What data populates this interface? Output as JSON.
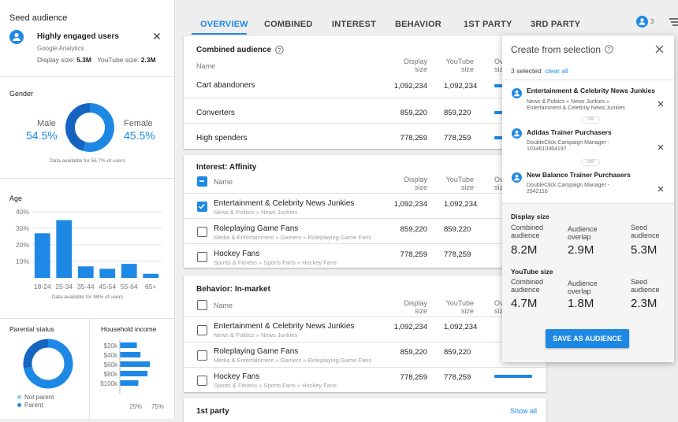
{
  "seed": {
    "header": "Seed audience",
    "name": "Highly engaged users",
    "source": "Google Analytics",
    "sizes": "Display size: 5.3M   YouTube size: 2.3M",
    "display_label": "Display size: ",
    "display_value": "5.3M",
    "youtube_label": "YouTube size: ",
    "youtube_value": "2.3M"
  },
  "gender": {
    "title": "Gender",
    "male_label": "Male",
    "male_pct": "54.5%",
    "female_label": "Female",
    "female_pct": "45.5%",
    "male_fraction": 0.545,
    "note": "Data available for 56.7% of users"
  },
  "age": {
    "title": "Age",
    "yticks": [
      "40%",
      "30%",
      "20%",
      "10%"
    ],
    "categories": [
      "18-24",
      "25-34",
      "35-44",
      "45-54",
      "55-64",
      "65+"
    ],
    "values": [
      27,
      35,
      7,
      5.5,
      8.5,
      2.5
    ],
    "ylim": [
      0,
      40
    ],
    "note": "Data available for 98% of users"
  },
  "parental": {
    "title": "Parental status",
    "legend": [
      "Not parent",
      "Parent"
    ],
    "not_parent_fraction": 0.72
  },
  "income": {
    "title": "Household income",
    "categories": [
      "$20k",
      "$40k",
      "$60k",
      "$80k",
      "$100k"
    ],
    "values": [
      0.48,
      0.58,
      0.85,
      0.78,
      0.52
    ],
    "axis": [
      "25%",
      "75%"
    ]
  },
  "tabs": [
    "OVERVIEW",
    "COMBINED",
    "INTEREST",
    "BEHAVIOR",
    "1ST PARTY",
    "3RD PARTY"
  ],
  "header_count": "3",
  "columns": {
    "name": "Name",
    "display1": "Display",
    "display2": "size",
    "youtube1": "YouTube",
    "youtube2": "size",
    "overlap1": "Ov",
    "overlap2": "siz"
  },
  "combined": {
    "title": "Combined audience",
    "rows": [
      {
        "name": "Cart abandoners",
        "display": "1,092,234",
        "youtube": "1,092,234"
      },
      {
        "name": "Converters",
        "display": "859,220",
        "youtube": "859,220"
      },
      {
        "name": "High spenders",
        "display": "778,259",
        "youtube": "778,259"
      }
    ]
  },
  "interest": {
    "title": "Interest: Affinity",
    "rows": [
      {
        "name": "Entertainment & Celebrity News Junkies",
        "path": "News & Politics » News Junkies",
        "display": "1,092,234",
        "youtube": "1,092,234",
        "checked": true
      },
      {
        "name": "Roleplaying Game Fans",
        "path": "Media & Entertainment » Gamers » Roleplaying Game Fans",
        "display": "859,220",
        "youtube": "859,220",
        "checked": false
      },
      {
        "name": "Hockey Fans",
        "path": "Sports & Fitness » Sports Fans » Hockey Fans",
        "display": "778,259",
        "youtube": "778,259",
        "checked": false
      }
    ]
  },
  "behavior": {
    "title": "Behavior: In-market",
    "rows": [
      {
        "name": "Entertainment & Celebrity News Junkies",
        "path": "News & Politics » News Junkies",
        "display": "1,092,234",
        "youtube": "1,092,234"
      },
      {
        "name": "Roleplaying Game Fans",
        "path": "Media & Entertainment » Gamers » Roleplaying Game Fans",
        "display": "859,220",
        "youtube": "859,220"
      },
      {
        "name": "Hockey Fans",
        "path": "Sports & Fitness » Sports Fans » Hockey Fans",
        "display": "778,259",
        "youtube": "778,259"
      }
    ]
  },
  "firstparty": {
    "title": "1st party",
    "show_all": "Show all"
  },
  "popup": {
    "title": "Create from selection",
    "selected": "3 selected",
    "clear_all": "clear all",
    "items": [
      {
        "name": "Entertainment & Celebrity News Junkies",
        "sub1": "News & Politics » News Junkies »",
        "sub2": "Entertainment & Celebrity News Junkies"
      },
      {
        "name": "Adidas Trainer Purchasers",
        "sub1": "DoubleClick Campaign Manager -",
        "sub2": "1034610364197"
      },
      {
        "name": "New Balance Trainer Purchasers",
        "sub1": "DoubleClick Campaign Manager -",
        "sub2": "2542116"
      }
    ],
    "or_label": "OR",
    "display_title": "Display size",
    "youtube_title": "YouTube size",
    "stat_labels": {
      "combined1": "Combined",
      "combined2": "audience",
      "overlap1": "Audience",
      "overlap2": "overlap",
      "seed1": "Seed",
      "seed2": "audience"
    },
    "display_values": [
      "8.2M",
      "2.9M",
      "5.3M"
    ],
    "youtube_values": [
      "4.7M",
      "1.8M",
      "2.3M"
    ],
    "save": "SAVE AS AUDIENCE"
  },
  "colors": {
    "accent": "#1e88e5",
    "light": "#e3f2fd"
  }
}
